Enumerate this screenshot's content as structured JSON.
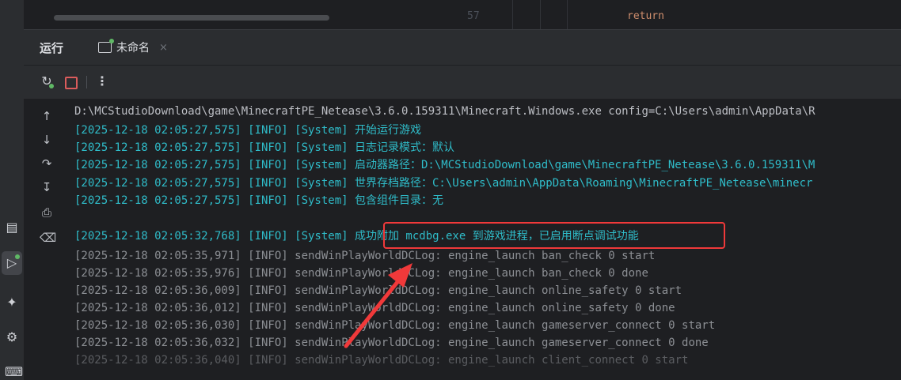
{
  "editor": {
    "line_number": "57",
    "code_keyword": "return"
  },
  "tool_window": {
    "title": "运行",
    "tab_label": "未命名",
    "tab_close": "×"
  },
  "toolbar": {
    "more": "⋮"
  },
  "console": {
    "command_line": "D:\\MCStudioDownload\\game\\MinecraftPE_Netease\\3.6.0.159311\\Minecraft.Windows.exe config=C:\\Users\\admin\\AppData\\R",
    "system_lines": [
      "[2025-12-18 02:05:27,575] [INFO] [System] 开始运行游戏",
      "[2025-12-18 02:05:27,575] [INFO] [System] 日志记录模式：默认",
      "[2025-12-18 02:05:27,575] [INFO] [System] 启动器路径：D:\\MCStudioDownload\\game\\MinecraftPE_Netease\\3.6.0.159311\\M",
      "[2025-12-18 02:05:27,575] [INFO] [System] 世界存档路径：C:\\Users\\admin\\AppData\\Roaming\\MinecraftPE_Netease\\minecr",
      "[2025-12-18 02:05:27,575] [INFO] [System] 包含组件目录：无",
      "[2025-12-18 02:05:32,768] [INFO] [System] 成功附加 mcdbg.exe 到游戏进程，已启用断点调试功能"
    ],
    "log_lines": [
      "[2025-12-18 02:05:35,971] [INFO] sendWinPlayWorldDCLog: engine_launch ban_check 0 start",
      "[2025-12-18 02:05:35,976] [INFO] sendWinPlayWorldDCLog: engine_launch ban_check 0 done",
      "[2025-12-18 02:05:36,009] [INFO] sendWinPlayWorldDCLog: engine_launch online_safety 0 start",
      "[2025-12-18 02:05:36,012] [INFO] sendWinPlayWorldDCLog: engine_launch online_safety 0 done",
      "[2025-12-18 02:05:36,030] [INFO] sendWinPlayWorldDCLog: engine_launch gameserver_connect 0 start",
      "[2025-12-18 02:05:36,032] [INFO] sendWinPlayWorldDCLog: engine_launch gameserver_connect 0 done",
      "[2025-12-18 02:05:36,040] [INFO] sendWinPlayWorldDCLog: engine_launch client_connect 0 start"
    ]
  },
  "colors": {
    "system_text": "#2fbcc9",
    "log_text": "#8c8f94",
    "annotation": "#f0393a"
  }
}
